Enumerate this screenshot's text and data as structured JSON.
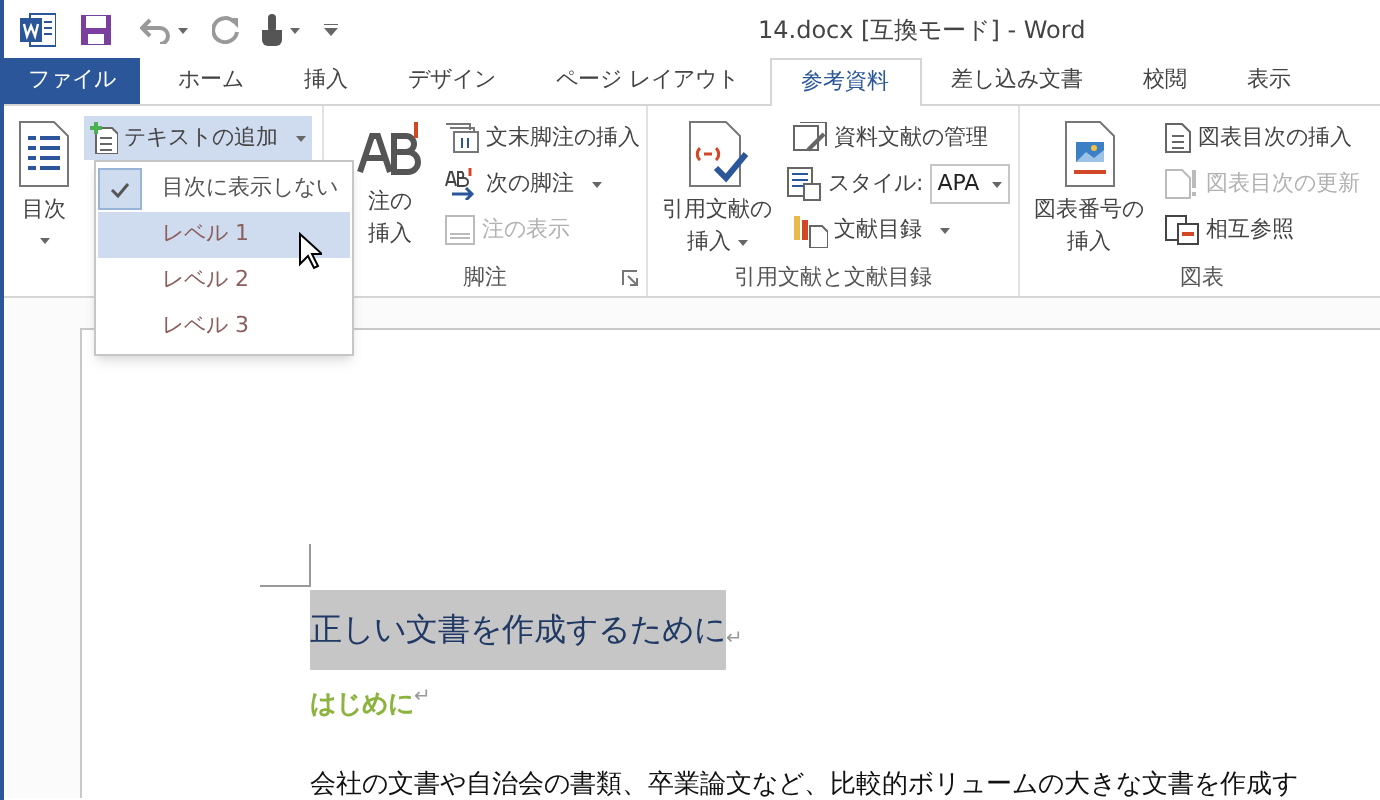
{
  "window": {
    "title": "14.docx [互換モード] - Word"
  },
  "tabs": [
    {
      "label": "ファイル",
      "kind": "file",
      "selected": false
    },
    {
      "label": "ホーム",
      "kind": "tab",
      "selected": false
    },
    {
      "label": "挿入",
      "kind": "tab",
      "selected": false
    },
    {
      "label": "デザイン",
      "kind": "tab",
      "selected": false
    },
    {
      "label": "ページ レイアウト",
      "kind": "tab",
      "selected": false
    },
    {
      "label": "参考資料",
      "kind": "tab",
      "selected": true
    },
    {
      "label": "差し込み文書",
      "kind": "tab",
      "selected": false
    },
    {
      "label": "校閲",
      "kind": "tab",
      "selected": false
    },
    {
      "label": "表示",
      "kind": "tab",
      "selected": false
    }
  ],
  "ribbon": {
    "groups": [
      {
        "large": {
          "lines": [
            "目次"
          ],
          "dropdown": true
        },
        "small": [
          {
            "kind": "button",
            "label": "テキストの追加",
            "dropdown": true,
            "expanded": true,
            "disabled": false
          }
        ]
      },
      {
        "label": "脚注",
        "launcher": true,
        "large": {
          "lines": [
            "注の",
            "挿入"
          ],
          "dropdown": false
        },
        "small": [
          {
            "kind": "button",
            "label": "文末脚注の挿入",
            "disabled": false
          },
          {
            "kind": "button",
            "label": "次の脚注",
            "dropdown": true,
            "disabled": false
          },
          {
            "kind": "button",
            "label": "注の表示",
            "dropdown": false,
            "disabled": true
          }
        ]
      },
      {
        "label": "引用文献と文献目録",
        "launcher": false,
        "large": {
          "lines": [
            "引用文献の",
            "挿入"
          ],
          "dropdown": true
        },
        "small": [
          {
            "kind": "button",
            "label": "資料文献の管理",
            "dropdown": false,
            "disabled": false
          },
          {
            "kind": "select",
            "label": "スタイル:",
            "value": "APA"
          },
          {
            "kind": "button",
            "label": "文献目録",
            "dropdown": true,
            "disabled": false
          }
        ]
      },
      {
        "label": "図表",
        "launcher": false,
        "large": {
          "lines": [
            "図表番号の",
            "挿入"
          ],
          "dropdown": false
        },
        "small": [
          {
            "kind": "button",
            "label": "図表目次の挿入",
            "dropdown": false,
            "disabled": false
          },
          {
            "kind": "button",
            "label": "図表目次の更新",
            "dropdown": false,
            "disabled": true
          },
          {
            "kind": "button",
            "label": "相互参照",
            "dropdown": false,
            "disabled": false
          }
        ]
      }
    ]
  },
  "menu": {
    "items": [
      {
        "label": "目次に表示しない",
        "checked": true,
        "selected": false
      },
      {
        "label": "レベル 1",
        "checked": false,
        "selected": true
      },
      {
        "label": "レベル 2",
        "checked": false,
        "selected": false
      },
      {
        "label": "レベル 3",
        "checked": false,
        "selected": false
      }
    ]
  },
  "document": {
    "paragraphs": [
      {
        "kind": "heading1",
        "text": "正しい文書を作成するために",
        "selected": true,
        "mark": "↵"
      },
      {
        "kind": "heading2",
        "text": "はじめに",
        "selected": false,
        "mark": "↵"
      },
      {
        "kind": "body",
        "text": "会社の文書や自治会の書類、卒業論文など、比較的ボリュームの大きな文書を作成す",
        "selected": false
      }
    ]
  }
}
